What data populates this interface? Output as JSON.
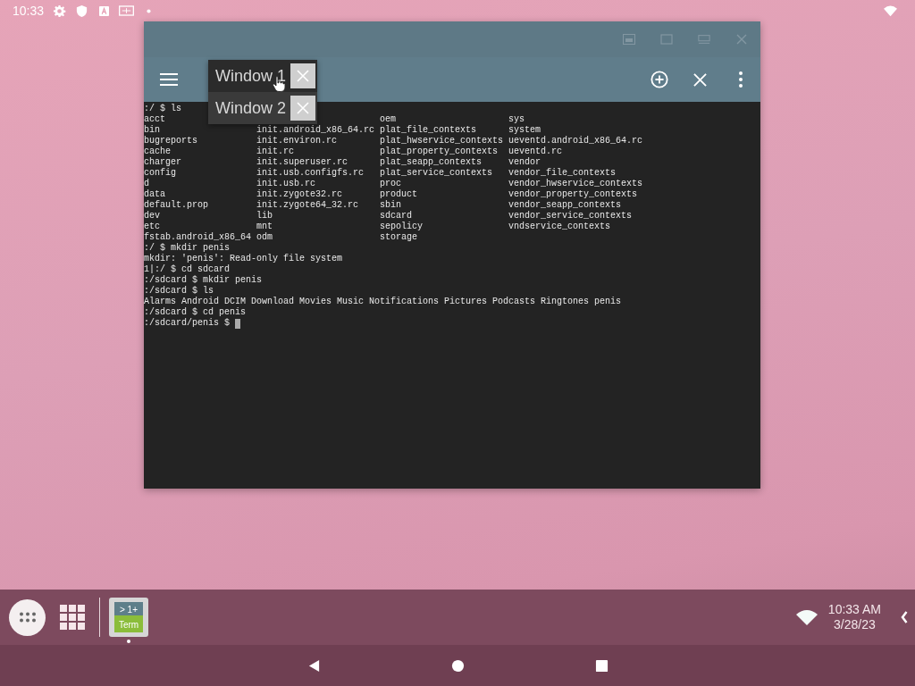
{
  "status_bar": {
    "time": "10:33"
  },
  "window": {
    "tabs": [
      {
        "label": "Window 1",
        "selected": true
      },
      {
        "label": "Window 2",
        "selected": false
      }
    ],
    "terminal": {
      "lines_before": [
        ":/ $ ls"
      ],
      "listing": [
        {
          "column_1": "acct",
          "column_3": "oem",
          "column_4": "sys"
        },
        {
          "column_1": "bin",
          "column_2": "init.android_x86_64.rc",
          "column_3": "plat_file_contexts",
          "column_4": "system"
        },
        {
          "column_1": "bugreports",
          "column_2": "init.environ.rc",
          "column_3": "plat_hwservice_contexts",
          "column_4": "ueventd.android_x86_64.rc"
        },
        {
          "column_1": "cache",
          "column_2": "init.rc",
          "column_3": "plat_property_contexts",
          "column_4": "ueventd.rc"
        },
        {
          "column_1": "charger",
          "column_2": "init.superuser.rc",
          "column_3": "plat_seapp_contexts",
          "column_4": "vendor"
        },
        {
          "column_1": "config",
          "column_2": "init.usb.configfs.rc",
          "column_3": "plat_service_contexts",
          "column_4": "vendor_file_contexts"
        },
        {
          "column_1": "d",
          "column_2": "init.usb.rc",
          "column_3": "proc",
          "column_4": "vendor_hwservice_contexts"
        },
        {
          "column_1": "data",
          "column_2": "init.zygote32.rc",
          "column_3": "product",
          "column_4": "vendor_property_contexts"
        },
        {
          "column_1": "default.prop",
          "column_2": "init.zygote64_32.rc",
          "column_3": "sbin",
          "column_4": "vendor_seapp_contexts"
        },
        {
          "column_1": "dev",
          "column_2": "lib",
          "column_3": "sdcard",
          "column_4": "vendor_service_contexts"
        },
        {
          "column_1": "etc",
          "column_2": "mnt",
          "column_3": "sepolicy",
          "column_4": "vndservice_contexts"
        },
        {
          "column_1": "fstab.android_x86_64",
          "column_2": "odm",
          "column_3": "storage"
        }
      ],
      "lines_after": [
        {
          "text": ":/ $ mkdir penis",
          "cursor": false
        },
        {
          "text": "mkdir: 'penis': Read-only file system",
          "cursor": false
        },
        {
          "text": "1|:/ $ cd sdcard",
          "cursor": false
        },
        {
          "text": ":/sdcard $ mkdir penis",
          "cursor": false
        },
        {
          "text": ":/sdcard $ ls",
          "cursor": false
        },
        {
          "text": "Alarms Android DCIM Download Movies Music Notifications Pictures Podcasts Ringtones penis",
          "cursor": false
        },
        {
          "text": ":/sdcard $ cd penis",
          "cursor": false
        },
        {
          "text": ":/sdcard/penis $",
          "cursor": true
        }
      ]
    }
  },
  "taskbar": {
    "app": {
      "line_1": "> 1+",
      "line_2": "Term"
    },
    "clock": {
      "time": "10:33 AM",
      "date": "3/28/23"
    }
  }
}
